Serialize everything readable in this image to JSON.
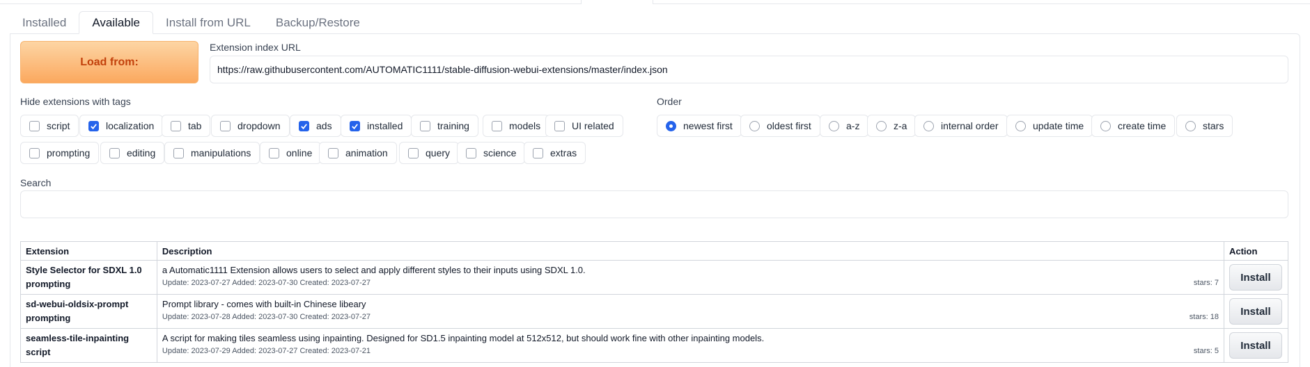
{
  "tabs": [
    {
      "label": "Installed"
    },
    {
      "label": "Available"
    },
    {
      "label": "Install from URL"
    },
    {
      "label": "Backup/Restore"
    }
  ],
  "load_button": "Load from:",
  "index_url": {
    "label": "Extension index URL",
    "value": "https://raw.githubusercontent.com/AUTOMATIC1111/stable-diffusion-webui-extensions/master/index.json"
  },
  "hide_tags": {
    "label": "Hide extensions with tags",
    "items": [
      {
        "label": "script",
        "checked": false
      },
      {
        "label": "localization",
        "checked": true
      },
      {
        "label": "tab",
        "checked": false
      },
      {
        "label": "dropdown",
        "checked": false
      },
      {
        "label": "ads",
        "checked": true
      },
      {
        "label": "installed",
        "checked": true
      },
      {
        "label": "training",
        "checked": false
      },
      {
        "label": "models",
        "checked": false
      },
      {
        "label": "UI related",
        "checked": false
      },
      {
        "label": "prompting",
        "checked": false
      },
      {
        "label": "editing",
        "checked": false
      },
      {
        "label": "manipulations",
        "checked": false
      },
      {
        "label": "online",
        "checked": false
      },
      {
        "label": "animation",
        "checked": false
      },
      {
        "label": "query",
        "checked": false
      },
      {
        "label": "science",
        "checked": false
      },
      {
        "label": "extras",
        "checked": false
      }
    ]
  },
  "order": {
    "label": "Order",
    "items": [
      {
        "label": "newest first",
        "checked": true
      },
      {
        "label": "oldest first",
        "checked": false
      },
      {
        "label": "a-z",
        "checked": false
      },
      {
        "label": "z-a",
        "checked": false
      },
      {
        "label": "internal order",
        "checked": false
      },
      {
        "label": "update time",
        "checked": false
      },
      {
        "label": "create time",
        "checked": false
      },
      {
        "label": "stars",
        "checked": false
      }
    ]
  },
  "search": {
    "label": "Search",
    "value": ""
  },
  "table": {
    "headers": [
      "Extension",
      "Description",
      "Action"
    ],
    "rows": [
      {
        "name": "Style Selector for SDXL 1.0",
        "tag": "prompting",
        "description": "a Automatic1111 Extension allows users to select and apply different styles to their inputs using SDXL 1.0.",
        "meta": "Update: 2023-07-27 Added: 2023-07-30 Created: 2023-07-27",
        "stars": "stars: 7",
        "action": "Install"
      },
      {
        "name": "sd-webui-oldsix-prompt",
        "tag": "prompting",
        "description": "Prompt library - comes with built-in Chinese libeary",
        "meta": "Update: 2023-07-28 Added: 2023-07-30 Created: 2023-07-27",
        "stars": "stars: 18",
        "action": "Install"
      },
      {
        "name": "seamless-tile-inpainting",
        "tag": "script",
        "description": "A script for making tiles seamless using inpainting. Designed for SD1.5 inpainting model at 512x512, but should work fine with other inpainting models.",
        "meta": "Update: 2023-07-29 Added: 2023-07-27 Created: 2023-07-21",
        "stars": "stars: 5",
        "action": "Install"
      }
    ]
  }
}
